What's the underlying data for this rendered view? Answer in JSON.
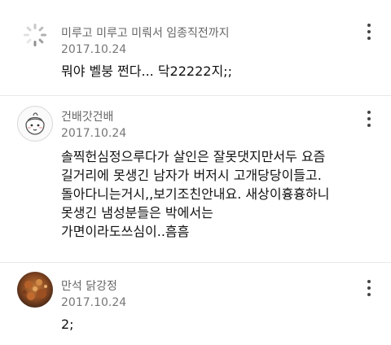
{
  "comments": [
    {
      "author": "미루고 미루고 미뤄서 임종직전까지",
      "date": "2017.10.24",
      "avatar_icon": "loading-spinner-icon",
      "lines": [
        "뭐야 벨붕 쩐다... 닥22222지;;"
      ]
    },
    {
      "author": "건배갓건배",
      "date": "2017.10.24",
      "avatar_icon": "cartoon-face-icon",
      "lines": [
        "솔찍헌심정으루다가 살인은 잘못댓지만서두 요즘",
        "길거리에 못생긴 남자가 버저시 고개당당이들고.",
        "돌아다니는거시,,보기조친안내요. 새상이흉흉하니",
        "못생긴 냄성분들은 박에서는",
        "가면이라도쓰심이..흠흠"
      ]
    },
    {
      "author": "만석 닭강정",
      "date": "2017.10.24",
      "avatar_icon": "food-photo-avatar",
      "lines": [
        "2;"
      ]
    }
  ],
  "more_icon": "more-vertical-icon",
  "colors": {
    "author": "#666666",
    "date": "#777777",
    "body": "#111111",
    "divider": "#e9e9e9"
  }
}
